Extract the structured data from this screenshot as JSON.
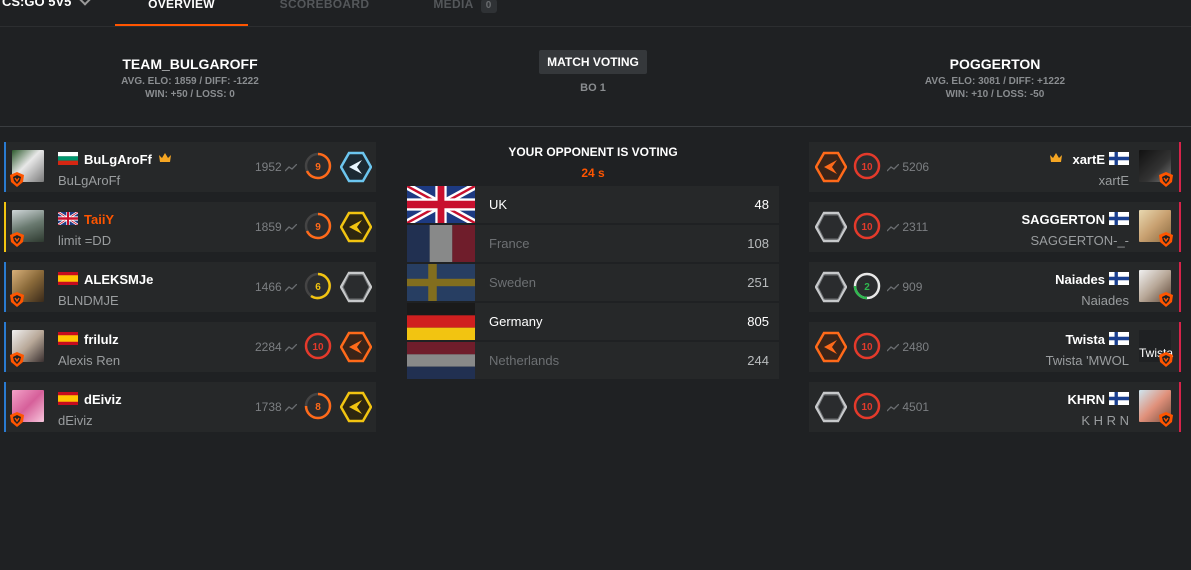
{
  "nav": {
    "game": "CS:GO 5V5",
    "tabs": [
      {
        "label": "OVERVIEW"
      },
      {
        "label": "SCOREBOARD"
      },
      {
        "label": "MEDIA",
        "badge": "0"
      }
    ]
  },
  "header": {
    "left_team": {
      "name": "TEAM_BULGAROFF",
      "avg": "AVG. ELO: 1859 / DIFF: -1222",
      "winloss": "WIN: +50 / LOSS: 0"
    },
    "right_team": {
      "name": "POGGERTON",
      "avg": "AVG. ELO: 3081 / DIFF: +1222",
      "winloss": "WIN: +10 / LOSS: -50"
    },
    "voting_label": "MATCH VOTING",
    "format": "BO 1"
  },
  "voting": {
    "title": "YOUR OPPONENT IS VOTING",
    "timer": "24 s",
    "maps": [
      {
        "name": "UK",
        "count": "48"
      },
      {
        "name": "France",
        "count": "108"
      },
      {
        "name": "Sweden",
        "count": "251"
      },
      {
        "name": "Germany",
        "count": "805"
      },
      {
        "name": "Netherlands",
        "count": "244"
      }
    ]
  },
  "left_players": [
    {
      "name": "BuLgAroFf",
      "nick": "BuLgAroFf",
      "elo": "1952",
      "level": "9",
      "country": "Bulgaria"
    },
    {
      "name": "TaiiY",
      "nick": "limit =DD",
      "elo": "1859",
      "level": "9",
      "country": "United Kingdom"
    },
    {
      "name": "ALEKSMJe",
      "nick": "BLNDMJE",
      "elo": "1466",
      "level": "6",
      "country": "Spain"
    },
    {
      "name": "frilulz",
      "nick": "Alexis Ren",
      "elo": "2284",
      "level": "10",
      "country": "Spain"
    },
    {
      "name": "dEiviz",
      "nick": "dEiviz",
      "elo": "1738",
      "level": "8",
      "country": "Spain"
    }
  ],
  "right_players": [
    {
      "name": "xartE",
      "nick": "xartE",
      "elo": "5206",
      "level": "10",
      "country": "Finland"
    },
    {
      "name": "SAGGERTON",
      "nick": "SAGGERTON-_-",
      "elo": "2311",
      "level": "10",
      "country": "Finland"
    },
    {
      "name": "Naiades",
      "nick": "Naiades",
      "elo": "909",
      "level": "2",
      "country": "Finland"
    },
    {
      "name": "Twista",
      "nick": "Twista 'MWOL",
      "elo": "2480",
      "level": "10",
      "country": "Finland",
      "avatar_alt": "Twista"
    },
    {
      "name": "KHRN",
      "nick": "K H R N",
      "elo": "4501",
      "level": "10",
      "country": "Finland"
    }
  ],
  "colors": {
    "accent": "#ff5500",
    "left_team": "#2a7bd1",
    "right_team": "#d6234a",
    "level_red": "#e43a2b"
  }
}
